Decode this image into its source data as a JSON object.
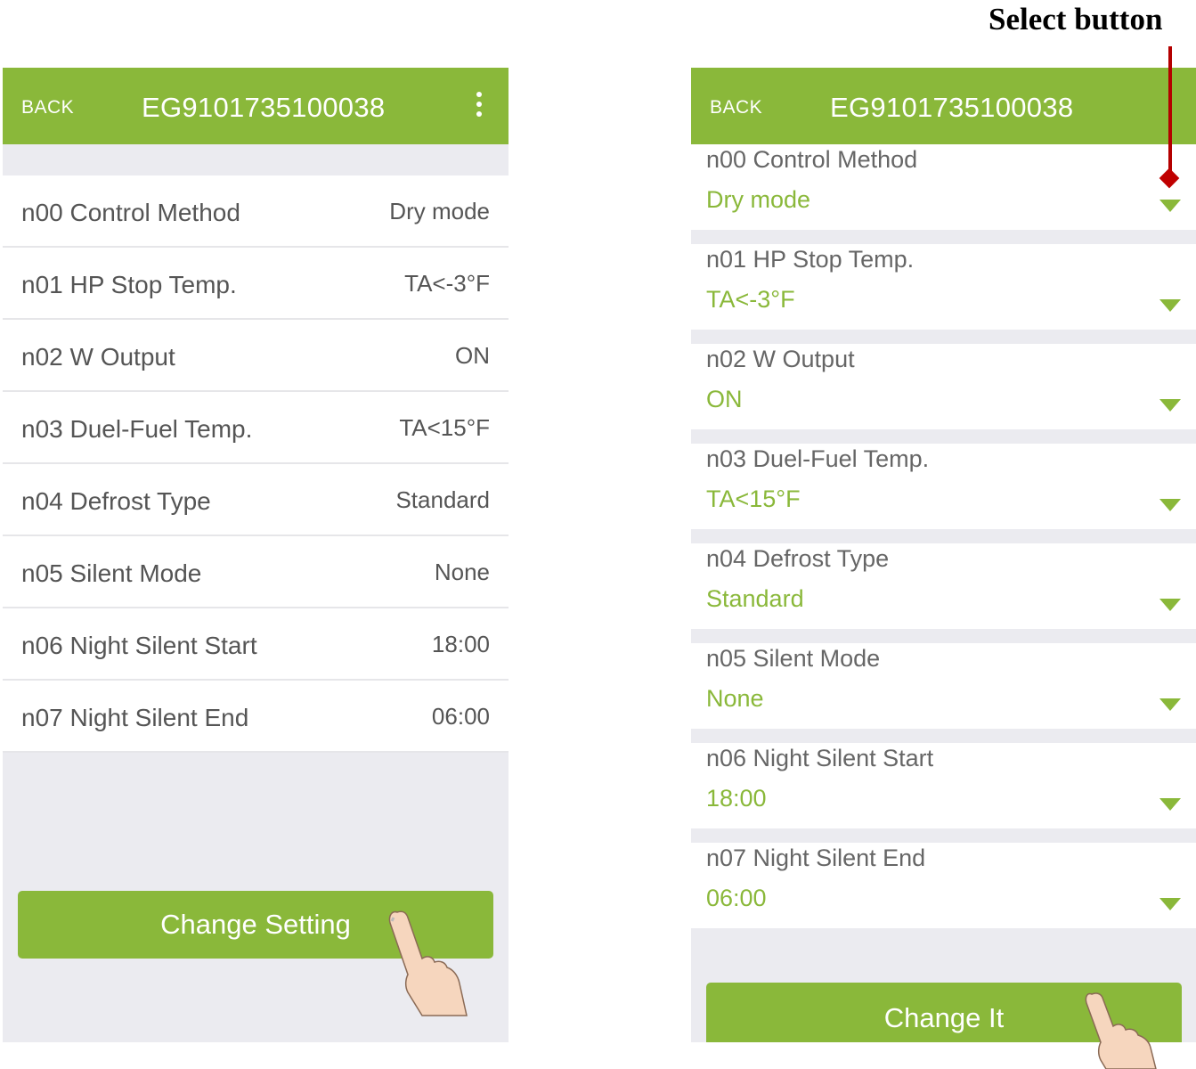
{
  "annotation": {
    "label": "Select button"
  },
  "left_screen": {
    "back_label": "BACK",
    "title": "EG9101735100038",
    "rows": [
      {
        "label": "n00 Control Method",
        "value": "Dry mode"
      },
      {
        "label": "n01 HP Stop Temp.",
        "value": "TA<-3°F"
      },
      {
        "label": "n02 W Output",
        "value": "ON"
      },
      {
        "label": "n03 Duel-Fuel Temp.",
        "value": "TA<15°F"
      },
      {
        "label": "n04 Defrost Type",
        "value": "Standard"
      },
      {
        "label": "n05 Silent Mode",
        "value": "None"
      },
      {
        "label": "n06 Night Silent Start",
        "value": "18:00"
      },
      {
        "label": "n07 Night Silent End",
        "value": "06:00"
      }
    ],
    "button_label": "Change Setting"
  },
  "right_screen": {
    "back_label": "BACK",
    "title": "EG9101735100038",
    "rows": [
      {
        "label": "n00 Control Method",
        "value": "Dry mode"
      },
      {
        "label": "n01 HP Stop Temp.",
        "value": "TA<-3°F"
      },
      {
        "label": "n02 W Output",
        "value": "ON"
      },
      {
        "label": "n03 Duel-Fuel Temp.",
        "value": "TA<15°F"
      },
      {
        "label": "n04 Defrost Type",
        "value": "Standard"
      },
      {
        "label": "n05 Silent Mode",
        "value": "None"
      },
      {
        "label": "n06 Night Silent Start",
        "value": "18:00"
      },
      {
        "label": "n07 Night Silent End",
        "value": "06:00"
      }
    ],
    "button_label": "Change It"
  },
  "colors": {
    "accent": "#8ab83a",
    "annotation": "#b40000"
  }
}
